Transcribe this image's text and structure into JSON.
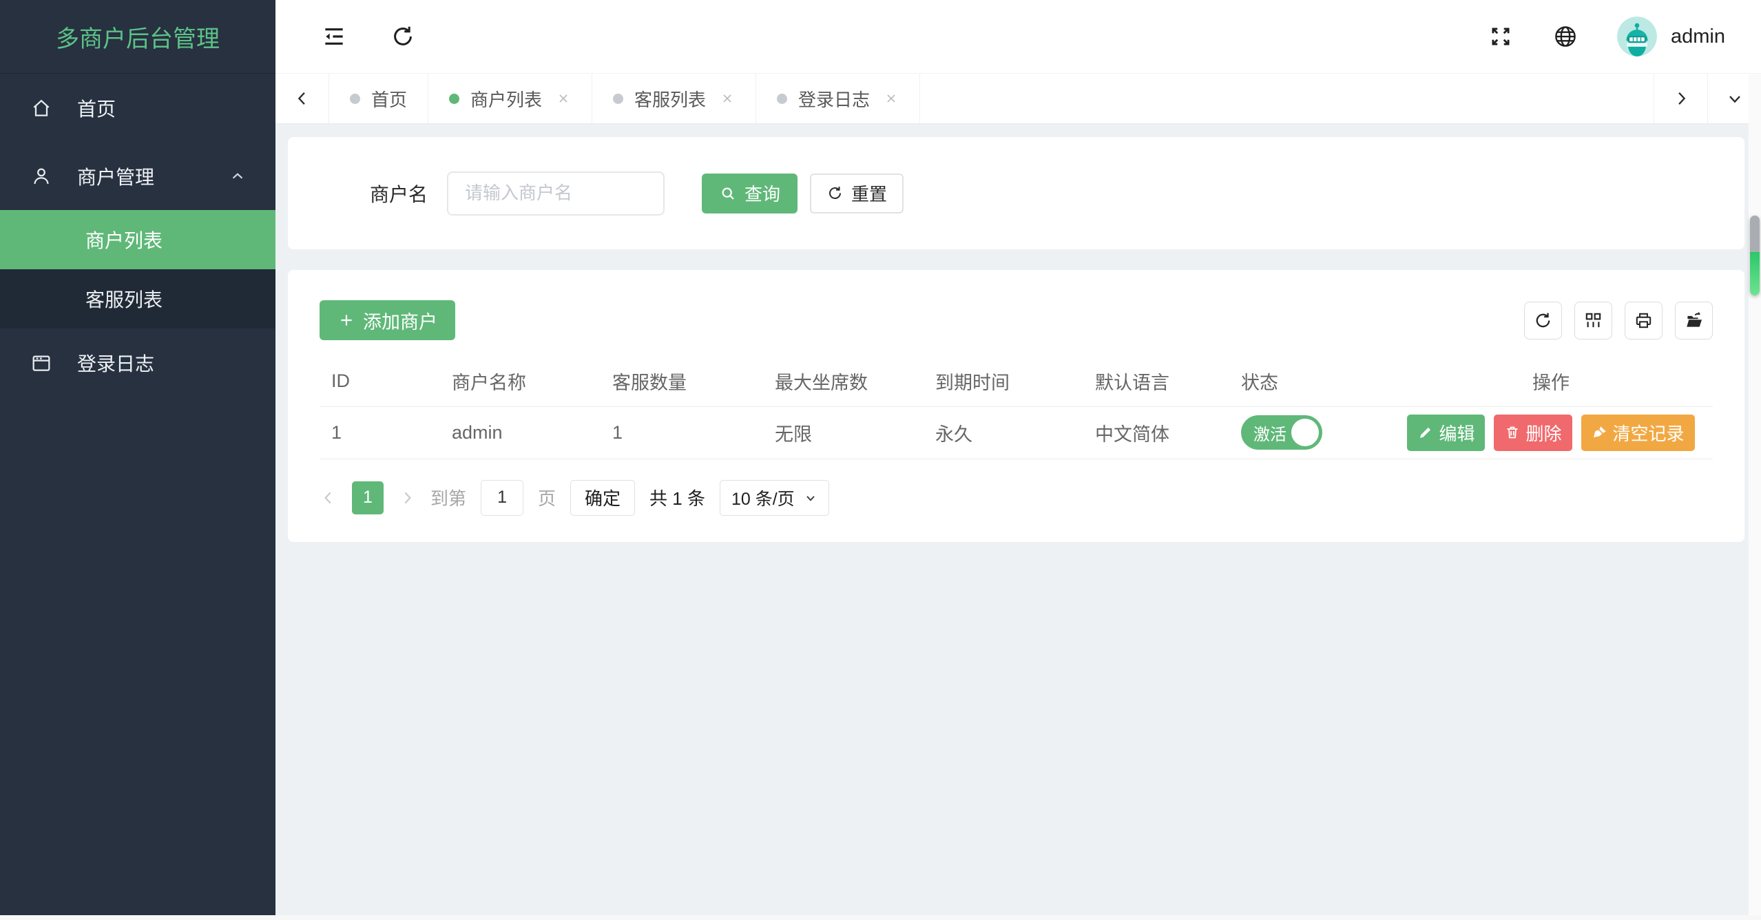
{
  "app": {
    "title": "多商户后台管理",
    "username": "admin"
  },
  "sidebar": {
    "home": "首页",
    "merchant_group": "商户管理",
    "merchant_list": "商户列表",
    "service_list": "客服列表",
    "login_log": "登录日志"
  },
  "tabs": {
    "items": [
      {
        "label": "首页"
      },
      {
        "label": "商户列表"
      },
      {
        "label": "客服列表"
      },
      {
        "label": "登录日志"
      }
    ]
  },
  "search": {
    "label": "商户名",
    "placeholder": "请输入商户名",
    "value": "",
    "query": "查询",
    "reset": "重置"
  },
  "table": {
    "add_button": "添加商户",
    "columns": [
      "ID",
      "商户名称",
      "客服数量",
      "最大坐席数",
      "到期时间",
      "默认语言",
      "状态",
      "操作"
    ],
    "row": {
      "id": "1",
      "name": "admin",
      "service_count": "1",
      "max_seats": "无限",
      "expire_time": "永久",
      "language": "中文简体",
      "status": "激活",
      "edit": "编辑",
      "delete": "删除",
      "clear": "清空记录"
    }
  },
  "pagination": {
    "page": "1",
    "goto_prefix": "到第",
    "goto_input": "1",
    "goto_suffix": "页",
    "confirm": "确定",
    "total": "共 1 条",
    "page_size": "10 条/页"
  },
  "icons": {
    "menu-fold-icon": "≡",
    "refresh-icon": "⟳",
    "fullscreen-icon": "⛶",
    "globe-icon": "🌐",
    "search-icon": "🔍",
    "plus-icon": "+",
    "columns-icon": "▦",
    "print-icon": "🖨",
    "export-icon": "📤",
    "edit-icon": "✎",
    "delete-icon": "🗑",
    "clear-icon": "🧹",
    "close-icon": "×",
    "chevron-left-icon": "‹",
    "chevron-right-icon": "›",
    "chevron-up-icon": "⌃",
    "chevron-down-icon": "⌄",
    "home-icon": "⌂",
    "user-icon": "👤",
    "log-icon": "📅"
  },
  "colors": {
    "accent": "#5FB878",
    "accent_title": "#5CC287",
    "danger": "#F0696C",
    "warning": "#F2A842",
    "sidebar_bg": "#273140",
    "submenu_bg": "#202A36",
    "page_bg": "#EEF1F4"
  }
}
